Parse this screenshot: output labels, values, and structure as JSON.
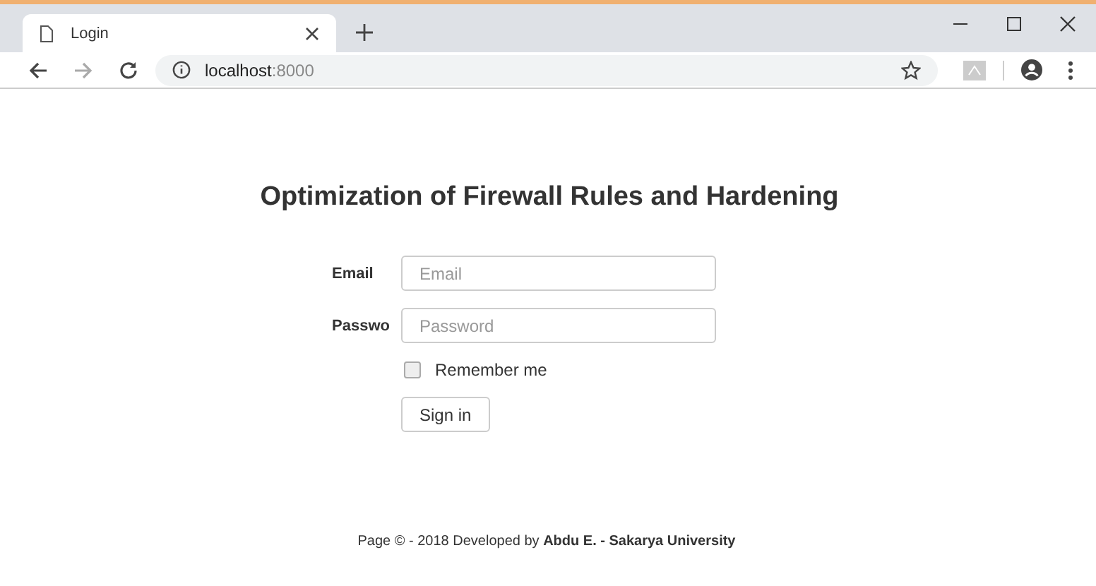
{
  "browser": {
    "tab": {
      "title": "Login",
      "selected": true
    },
    "url": {
      "host": "localhost",
      "port": ":8000"
    }
  },
  "page": {
    "title": "Optimization of Firewall Rules and Hardening",
    "fields": [
      {
        "label": "Email",
        "placeholder": "Email"
      },
      {
        "label": "Passwo",
        "placeholder": "Password"
      }
    ],
    "remember": {
      "label": "Remember me",
      "checked": false
    },
    "submit": "Sign in",
    "footer": "Page © - 2018 Developed by **Abdu E. - Sakarya University**"
  }
}
